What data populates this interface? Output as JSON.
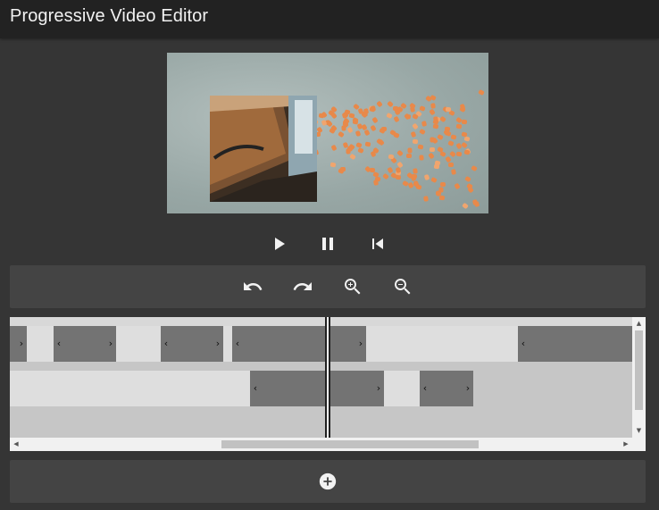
{
  "app": {
    "title": "Progressive Video Editor"
  },
  "preview": {
    "icon": "video-preview"
  },
  "transport": {
    "play": {
      "icon": "play-icon"
    },
    "pause": {
      "icon": "pause-icon"
    },
    "rewind": {
      "icon": "skip-to-start-icon"
    }
  },
  "toolbar": {
    "undo": {
      "icon": "undo-icon"
    },
    "redo": {
      "icon": "redo-icon"
    },
    "zoom_in": {
      "icon": "zoom-in-icon"
    },
    "zoom_out": {
      "icon": "zoom-out-icon"
    }
  },
  "timeline": {
    "handle_left": "‹",
    "handle_right": "›",
    "scroll_up": "▲",
    "scroll_down": "▼",
    "scroll_left": "◀",
    "scroll_right": "▶"
  },
  "add_track": {
    "icon": "add-circle-icon"
  },
  "colors": {
    "background": "#353535",
    "appbar": "#222222",
    "panel": "#444444",
    "clip": "#737373",
    "gap": "#dedede",
    "timeline": "#c6c6c6",
    "accent_orange": "#e8894a"
  }
}
